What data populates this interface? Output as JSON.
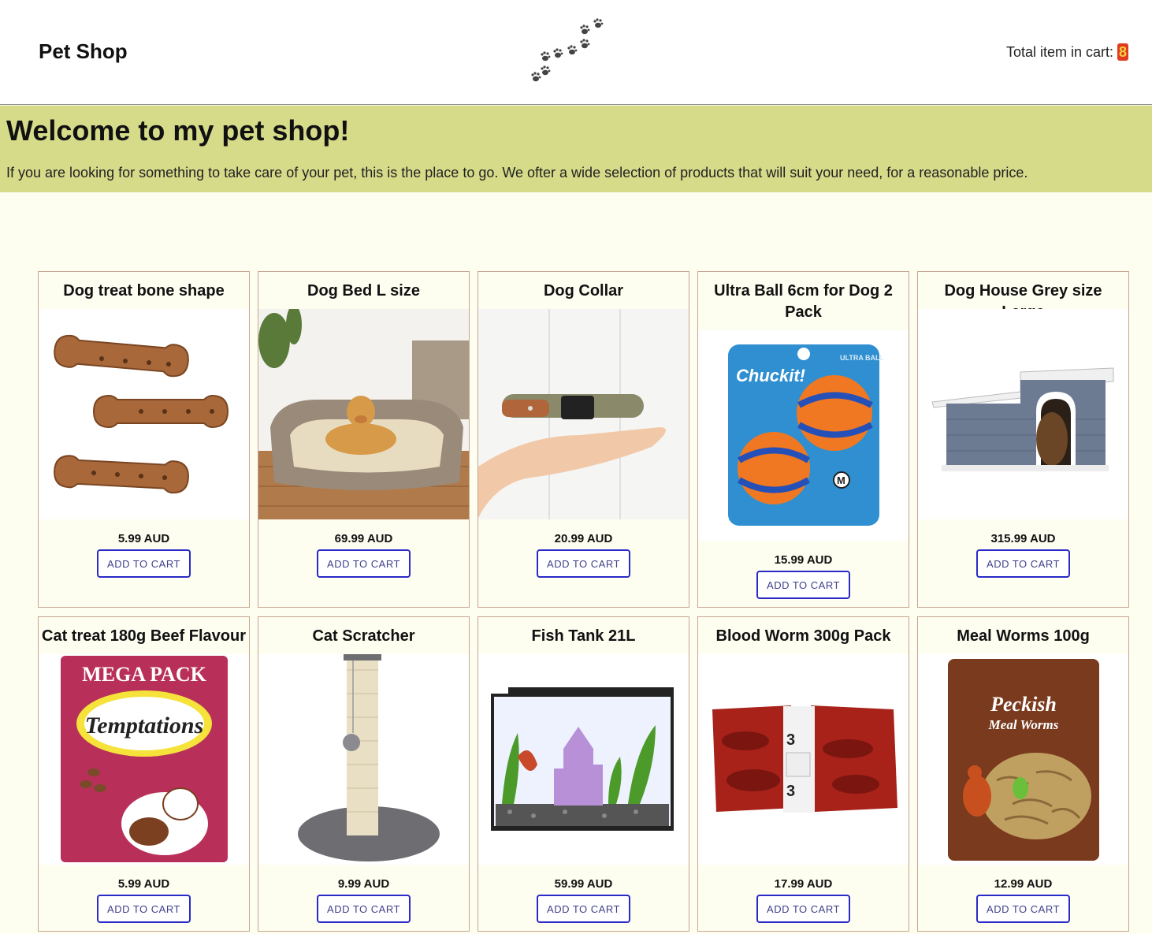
{
  "header": {
    "brand": "Pet Shop",
    "cart_label": "Total item in cart: ",
    "cart_count": "8"
  },
  "hero": {
    "title": "Welcome to my pet shop!",
    "text": "If you are looking for something to take care of your pet, this is the place to go. We ofter a wide selection of products that will suit your need, for a reasonable price."
  },
  "products": [
    {
      "title": "Dog treat bone shape",
      "price": "5.99 AUD",
      "button": "ADD TO CART"
    },
    {
      "title": "Dog Bed L size",
      "price": "69.99 AUD",
      "button": "ADD TO CART"
    },
    {
      "title": "Dog Collar",
      "price": "20.99 AUD",
      "button": "ADD TO CART"
    },
    {
      "title": "Ultra Ball 6cm for Dog 2 Pack",
      "price": "15.99 AUD",
      "button": "ADD TO CART",
      "image_text": [
        "Chuckit!",
        "ULTRA BALL"
      ]
    },
    {
      "title": "Dog House Grey size Large",
      "price": "315.99 AUD",
      "button": "ADD TO CART"
    },
    {
      "title": "Cat treat 180g Beef Flavour",
      "price": "5.99 AUD",
      "button": "ADD TO CART",
      "image_text": [
        "MEGA PACK",
        "Temptations"
      ]
    },
    {
      "title": "Cat Scratcher",
      "price": "9.99 AUD",
      "button": "ADD TO CART"
    },
    {
      "title": "Fish Tank 21L",
      "price": "59.99 AUD",
      "button": "ADD TO CART"
    },
    {
      "title": "Blood Worm 300g Pack",
      "price": "17.99 AUD",
      "button": "ADD TO CART"
    },
    {
      "title": "Meal Worms 100g",
      "price": "12.99 AUD",
      "button": "ADD TO CART",
      "image_text": [
        "Peckish",
        "Meal Worms"
      ]
    }
  ],
  "colors": {
    "hero_bg": "#d6db8a",
    "page_bg": "#fdfdf0",
    "button_border": "#2a2ac8",
    "card_border": "#c8a592"
  },
  "icons": {
    "logo": "paw-prints-icon"
  }
}
